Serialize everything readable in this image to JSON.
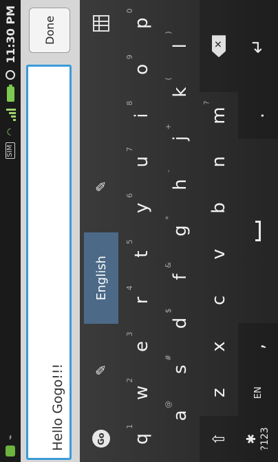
{
  "status_bar": {
    "time": "11:30 PM",
    "sim_label": "SIM"
  },
  "text_input": {
    "value": "Hello Gogo!!!"
  },
  "done_button": {
    "label": "Done"
  },
  "keyboard": {
    "language": "English",
    "row1": [
      {
        "char": "q",
        "hint": "1"
      },
      {
        "char": "w",
        "hint": "2"
      },
      {
        "char": "e",
        "hint": "3"
      },
      {
        "char": "r",
        "hint": "4"
      },
      {
        "char": "t",
        "hint": "5"
      },
      {
        "char": "y",
        "hint": "6"
      },
      {
        "char": "u",
        "hint": "7"
      },
      {
        "char": "i",
        "hint": "8"
      },
      {
        "char": "o",
        "hint": "9"
      },
      {
        "char": "p",
        "hint": "0"
      }
    ],
    "row2": [
      {
        "char": "a",
        "hint": "@"
      },
      {
        "char": "s",
        "hint": "#"
      },
      {
        "char": "d",
        "hint": "$"
      },
      {
        "char": "f",
        "hint": "&"
      },
      {
        "char": "g",
        "hint": "*"
      },
      {
        "char": "h",
        "hint": "-"
      },
      {
        "char": "j",
        "hint": "+"
      },
      {
        "char": "k",
        "hint": "("
      },
      {
        "char": "l",
        "hint": ")"
      }
    ],
    "row3": [
      {
        "char": "z",
        "hint": ""
      },
      {
        "char": "x",
        "hint": ""
      },
      {
        "char": "c",
        "hint": ""
      },
      {
        "char": "v",
        "hint": ""
      },
      {
        "char": "b",
        "hint": ""
      },
      {
        "char": "n",
        "hint": ""
      },
      {
        "char": "m",
        "hint": "?"
      }
    ],
    "symbols_label": "?123",
    "lang_switch_label": "EN",
    "comma": ",",
    "period": "."
  },
  "colors": {
    "accent_border": "#3a9ad9",
    "keyboard_bg": "#2b2b2b",
    "language_pill": "#4c6a88",
    "status_green": "#7ec94f"
  }
}
